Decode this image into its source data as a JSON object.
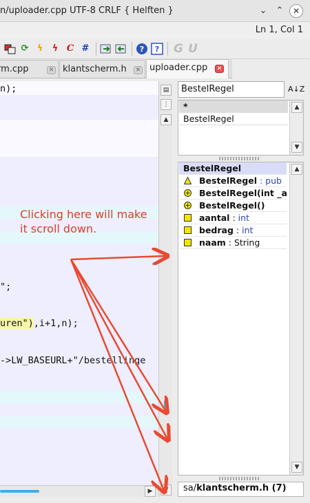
{
  "window": {
    "title": "n/uploader.cpp UTF-8 CRLF { Helften }",
    "buttons": {
      "minimize": "⌄",
      "maximize": "⌃",
      "close": "✕"
    }
  },
  "status": {
    "position": "Ln 1, Col 1"
  },
  "toolbar": {
    "icons": [
      "tile-icon",
      "refresh-icon",
      "lightning-icon",
      "lightning-red-icon",
      "italic-c-icon",
      "hash-icon",
      "export-icon",
      "import-icon",
      "help-icon",
      "context-help-icon",
      "g-icon",
      "u-icon"
    ]
  },
  "tabs": [
    {
      "label": "rm.cpp",
      "active": false
    },
    {
      "label": "klantscherm.h",
      "active": false
    },
    {
      "label": "uploader.cpp",
      "active": true
    }
  ],
  "editor": {
    "lines": [
      {
        "text": "n);"
      },
      {
        "text": "\";"
      },
      {
        "pre": "uren\"",
        "mid": ")",
        "post": ",i+1,n);"
      },
      {
        "pre": "->LW_BASEURL+",
        "str": "\"/bestellinge"
      }
    ]
  },
  "outline": {
    "search_value": "BestelRegel",
    "sort_icon": "A↓Z",
    "classes": [
      "*",
      "BestelRegel"
    ],
    "selected_class": "BestelRegel",
    "members": [
      {
        "icon": "triangle-icon",
        "name": "BestelRegel",
        "suffix": " : pub"
      },
      {
        "icon": "circle-plus-icon",
        "name": "BestelRegel",
        "suffix": "(int _a"
      },
      {
        "icon": "circle-plus-icon",
        "name": "BestelRegel",
        "suffix": "()"
      },
      {
        "icon": "square-icon",
        "name": "aantal",
        "sep": " : ",
        "type": "int"
      },
      {
        "icon": "square-icon",
        "name": "bedrag",
        "sep": " : ",
        "type": "int"
      },
      {
        "icon": "square-icon",
        "name": "naam",
        "sep": " : ",
        "type": "String"
      }
    ],
    "file_prefix": "sa/",
    "file_name": "klantscherm.h",
    "file_count": " (7)"
  },
  "annotation": {
    "text": "Clicking here will make it scroll down.",
    "color": "#e03c28"
  }
}
